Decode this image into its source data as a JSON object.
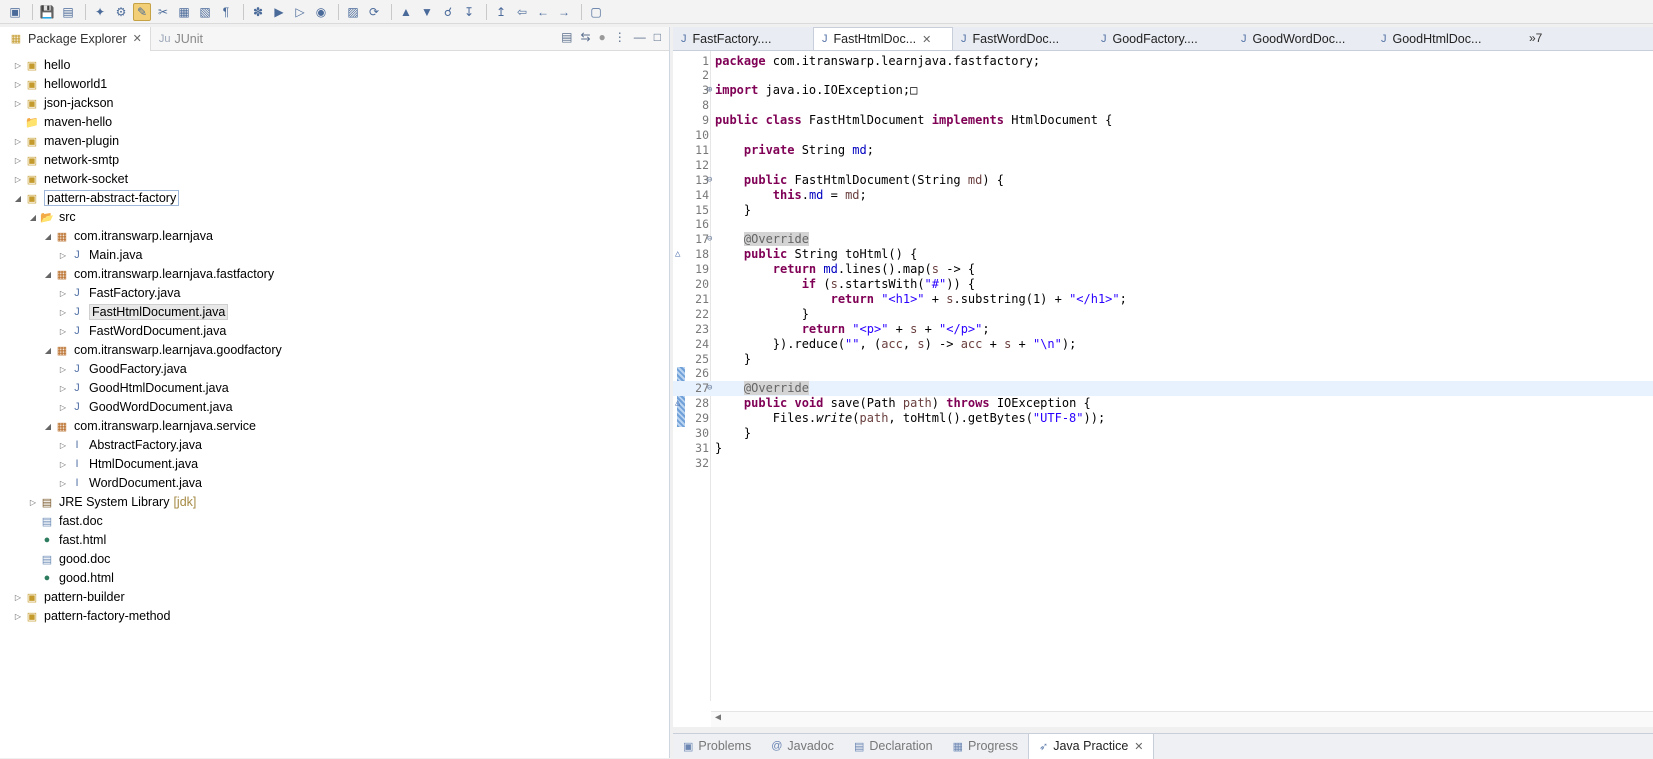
{
  "toolbar": {
    "icons": [
      "new-icon",
      "save-icon",
      "save-all-icon",
      "pin-icon",
      "debug-icon",
      "highlight-icon",
      "cut-icon",
      "copy-icon",
      "paste-icon",
      "pilcrow-icon",
      "bug-icon",
      "run-icon",
      "run-as-icon",
      "external-tools-icon",
      "new-package-icon",
      "refresh-icon",
      "open-type-icon",
      "open-resource-icon",
      "search-icon",
      "next-annotation-icon",
      "prev-annotation-icon",
      "last-edit-icon",
      "back-icon",
      "forward-icon",
      "perspective-icon"
    ]
  },
  "left_view": {
    "tabs": [
      {
        "label": "Package Explorer",
        "active": true
      },
      {
        "label": "JUnit",
        "prefix": "Ju",
        "active": false
      }
    ]
  },
  "tree": [
    {
      "label": "hello",
      "depth": 0,
      "icon": "project",
      "expanded": false
    },
    {
      "label": "helloworld1",
      "depth": 0,
      "icon": "project",
      "expanded": false
    },
    {
      "label": "json-jackson",
      "depth": 0,
      "icon": "maven",
      "expanded": false
    },
    {
      "label": "maven-hello",
      "depth": 0,
      "icon": "folder",
      "expanded": null
    },
    {
      "label": "maven-plugin",
      "depth": 0,
      "icon": "maven",
      "expanded": false
    },
    {
      "label": "network-smtp",
      "depth": 0,
      "icon": "maven",
      "expanded": false
    },
    {
      "label": "network-socket",
      "depth": 0,
      "icon": "project",
      "expanded": false
    },
    {
      "label": "pattern-abstract-factory",
      "depth": 0,
      "icon": "project",
      "expanded": true,
      "selected": true
    },
    {
      "label": "src",
      "depth": 1,
      "icon": "srcfolder",
      "expanded": true
    },
    {
      "label": "com.itranswarp.learnjava",
      "depth": 2,
      "icon": "package",
      "expanded": true
    },
    {
      "label": "Main.java",
      "depth": 3,
      "icon": "java",
      "expanded": false
    },
    {
      "label": "com.itranswarp.learnjava.fastfactory",
      "depth": 2,
      "icon": "package",
      "expanded": true
    },
    {
      "label": "FastFactory.java",
      "depth": 3,
      "icon": "java",
      "expanded": false
    },
    {
      "label": "FastHtmlDocument.java",
      "depth": 3,
      "icon": "java",
      "expanded": false,
      "highlighted": true
    },
    {
      "label": "FastWordDocument.java",
      "depth": 3,
      "icon": "java",
      "expanded": false
    },
    {
      "label": "com.itranswarp.learnjava.goodfactory",
      "depth": 2,
      "icon": "package",
      "expanded": true
    },
    {
      "label": "GoodFactory.java",
      "depth": 3,
      "icon": "java",
      "expanded": false
    },
    {
      "label": "GoodHtmlDocument.java",
      "depth": 3,
      "icon": "java",
      "expanded": false
    },
    {
      "label": "GoodWordDocument.java",
      "depth": 3,
      "icon": "java",
      "expanded": false
    },
    {
      "label": "com.itranswarp.learnjava.service",
      "depth": 2,
      "icon": "package",
      "expanded": true
    },
    {
      "label": "AbstractFactory.java",
      "depth": 3,
      "icon": "interface",
      "expanded": false
    },
    {
      "label": "HtmlDocument.java",
      "depth": 3,
      "icon": "interface",
      "expanded": false
    },
    {
      "label": "WordDocument.java",
      "depth": 3,
      "icon": "interface",
      "expanded": false
    },
    {
      "label": "JRE System Library",
      "suffix": "[jdk]",
      "depth": 1,
      "icon": "jre",
      "expanded": false
    },
    {
      "label": "fast.doc",
      "depth": 1,
      "icon": "file",
      "expanded": null
    },
    {
      "label": "fast.html",
      "depth": 1,
      "icon": "globe",
      "expanded": null
    },
    {
      "label": "good.doc",
      "depth": 1,
      "icon": "file",
      "expanded": null
    },
    {
      "label": "good.html",
      "depth": 1,
      "icon": "globe",
      "expanded": null
    },
    {
      "label": "pattern-builder",
      "depth": 0,
      "icon": "project",
      "expanded": false
    },
    {
      "label": "pattern-factory-method",
      "depth": 0,
      "icon": "project",
      "expanded": false
    }
  ],
  "editor": {
    "tabs": [
      {
        "label": "FastFactory....",
        "active": false
      },
      {
        "label": "FastHtmlDoc...",
        "active": true
      },
      {
        "label": "FastWordDoc...",
        "active": false
      },
      {
        "label": "GoodFactory....",
        "active": false
      },
      {
        "label": "GoodWordDoc...",
        "active": false
      },
      {
        "label": "GoodHtmlDoc...",
        "active": false
      }
    ],
    "more_tabs": "»7",
    "lines": [
      {
        "n": "1",
        "html": "<span class=\"kw\">package</span> com.itranswarp.learnjava.fastfactory;"
      },
      {
        "n": "2",
        "html": ""
      },
      {
        "n": "3",
        "html": "<span class=\"kw\">import</span> java.io.IOException;□",
        "fold": "⊕"
      },
      {
        "n": "8",
        "html": ""
      },
      {
        "n": "9",
        "html": "<span class=\"kw\">public class</span> FastHtmlDocument <span class=\"kw\">implements</span> HtmlDocument {"
      },
      {
        "n": "10",
        "html": ""
      },
      {
        "n": "11",
        "html": "    <span class=\"kw\">private</span> String <span class=\"fld\">md</span>;"
      },
      {
        "n": "12",
        "html": ""
      },
      {
        "n": "13",
        "html": "    <span class=\"kw\">public</span> FastHtmlDocument(String <span class=\"par\">md</span>) {",
        "fold": "⊖"
      },
      {
        "n": "14",
        "html": "        <span class=\"kw\">this</span>.<span class=\"fld\">md</span> = <span class=\"par\">md</span>;"
      },
      {
        "n": "15",
        "html": "    }"
      },
      {
        "n": "16",
        "html": ""
      },
      {
        "n": "17",
        "html": "    <span class=\"ann\">@Override</span>",
        "fold": "⊖"
      },
      {
        "n": "18",
        "html": "    <span class=\"kw\">public</span> String toHtml() {",
        "mark": "△"
      },
      {
        "n": "19",
        "html": "        <span class=\"kw\">return</span> <span class=\"fld\">md</span>.lines().map(<span class=\"par\">s</span> -> {"
      },
      {
        "n": "20",
        "html": "            <span class=\"kw\">if</span> (<span class=\"par\">s</span>.startsWith(<span class=\"str\">\"#\"</span>)) {"
      },
      {
        "n": "21",
        "html": "                <span class=\"kw\">return</span> <span class=\"str\">\"&lt;h1&gt;\"</span> + <span class=\"par\">s</span>.substring(1) + <span class=\"str\">\"&lt;/h1&gt;\"</span>;"
      },
      {
        "n": "22",
        "html": "            }"
      },
      {
        "n": "23",
        "html": "            <span class=\"kw\">return</span> <span class=\"str\">\"&lt;p&gt;\"</span> + <span class=\"par\">s</span> + <span class=\"str\">\"&lt;/p&gt;\"</span>;"
      },
      {
        "n": "24",
        "html": "        }).reduce(<span class=\"str\">\"\"</span>, (<span class=\"par\">acc</span>, <span class=\"par\">s</span>) -> <span class=\"par\">acc</span> + <span class=\"par\">s</span> + <span class=\"str\">\"\\n\"</span>);"
      },
      {
        "n": "25",
        "html": "    }"
      },
      {
        "n": "26",
        "html": ""
      },
      {
        "n": "27",
        "html": "    <span class=\"ann\">@Override</span>",
        "fold": "⊖",
        "current": true
      },
      {
        "n": "28",
        "html": "    <span class=\"kw\">public void</span> save(Path <span class=\"par\">path</span>) <span class=\"kw\">throws</span> IOException {",
        "mark": "△"
      },
      {
        "n": "29",
        "html": "        Files.<span class=\"sm\">write</span>(<span class=\"par\">path</span>, toHtml().getBytes(<span class=\"str\">\"UTF-8\"</span>));"
      },
      {
        "n": "30",
        "html": "    }"
      },
      {
        "n": "31",
        "html": "}"
      },
      {
        "n": "32",
        "html": ""
      }
    ]
  },
  "bottom_tabs": [
    {
      "label": "Problems",
      "icon": "problems-icon",
      "glyph": "▣",
      "active": false
    },
    {
      "label": "Javadoc",
      "icon": "javadoc-icon",
      "glyph": "@",
      "active": false
    },
    {
      "label": "Declaration",
      "icon": "declaration-icon",
      "glyph": "▤",
      "active": false
    },
    {
      "label": "Progress",
      "icon": "progress-icon",
      "glyph": "▦",
      "active": false
    },
    {
      "label": "Java Practice",
      "icon": "rocket-icon",
      "glyph": "➶",
      "active": true
    }
  ]
}
